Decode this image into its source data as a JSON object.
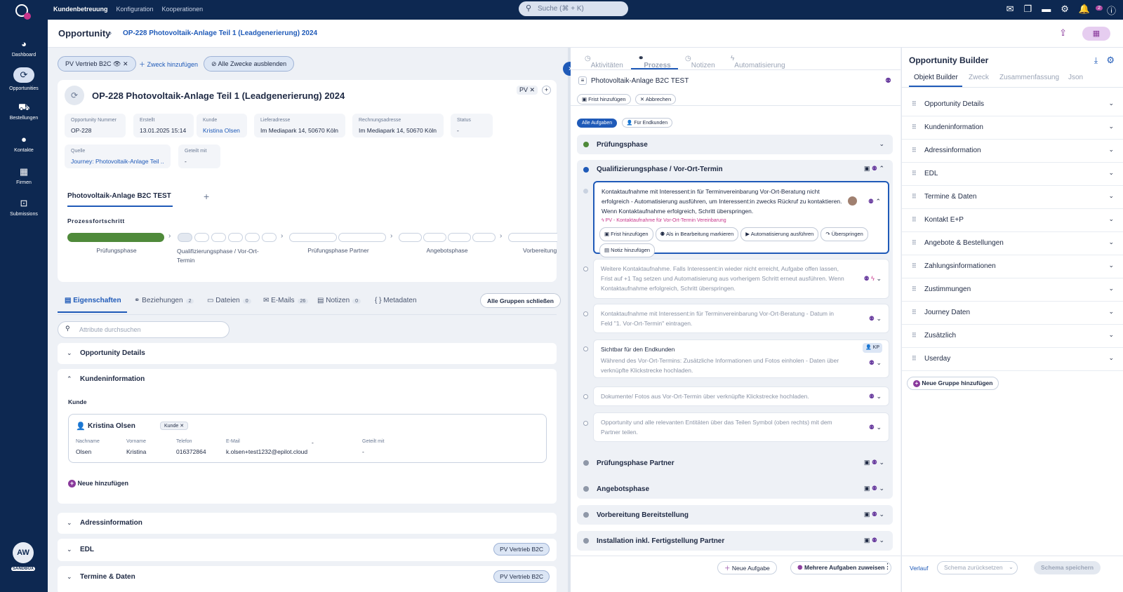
{
  "topnav": {
    "items": [
      "Kundenbetreuung",
      "Konfiguration",
      "Kooperationen"
    ],
    "search_placeholder": "Suche (⌘ + K)",
    "notifications_count": "2"
  },
  "sidebar": {
    "items": [
      "Dashboard",
      "Opportunities",
      "Bestellungen",
      "Kontakte",
      "Firmen",
      "Submissions"
    ],
    "avatar": "AW",
    "env": "SANDBOX"
  },
  "breadcrumb": {
    "root": "Opportunity",
    "current": "OP-228 Photovoltaik-Anlage Teil 1 (Leadgenerierung) 2024"
  },
  "purposes": {
    "chip": "PV Vertrieb B2C",
    "add": "Zweck hinzufügen",
    "hide_all": "Alle Zwecke ausblenden"
  },
  "header": {
    "title": "OP-228 Photovoltaik-Anlage Teil 1 (Leadgenerierung) 2024",
    "tag": "PV",
    "fields": [
      {
        "label": "Opportunity Nummer",
        "value": "OP-228"
      },
      {
        "label": "Erstellt",
        "value": "13.01.2025 15:14"
      },
      {
        "label": "Kunde",
        "value": "Kristina Olsen"
      },
      {
        "label": "Lieferadresse",
        "value": "Im Mediapark 14, 50670 Köln"
      },
      {
        "label": "Rechnungsadresse",
        "value": "Im Mediapark 14, 50670 Köln"
      },
      {
        "label": "Status",
        "value": "-"
      },
      {
        "label": "Quelle",
        "value": "Journey: Photovoltaik-Anlage Teil ..."
      },
      {
        "label": "Geteilt mit",
        "value": "-"
      }
    ]
  },
  "workflow": {
    "tab": "Photovoltaik-Anlage B2C TEST",
    "progress_title": "Prozessfortschritt",
    "phases": [
      "Prüfungsphase",
      "Qualifizierungsphase / Vor-Ort-Termin",
      "Prüfungsphase Partner",
      "Angebotsphase",
      "Vorbereitung"
    ]
  },
  "entity_tabs": [
    {
      "label": "Eigenschaften",
      "count": ""
    },
    {
      "label": "Beziehungen",
      "count": "2"
    },
    {
      "label": "Dateien",
      "count": "0"
    },
    {
      "label": "E-Mails",
      "count": "26"
    },
    {
      "label": "Notizen",
      "count": "0"
    },
    {
      "label": "Metadaten",
      "count": ""
    }
  ],
  "close_groups": "Alle Gruppen schließen",
  "attr_search_placeholder": "Attribute durchsuchen",
  "groups": {
    "details": "Opportunity Details",
    "customer": "Kundeninformation",
    "address": "Adressinformation",
    "edl": "EDL",
    "termine": "Termine & Daten",
    "purpose_badge": "PV Vertrieb B2C"
  },
  "customer": {
    "section_label": "Kunde",
    "name": "Kristina Olsen",
    "role": "Kunde",
    "columns": [
      "Nachname",
      "Vorname",
      "Telefon",
      "E-Mail",
      "",
      "Geteilt mit"
    ],
    "values": [
      "Olsen",
      "Kristina",
      "016372864",
      "k.olsen+test1232@epilot.cloud",
      "-",
      "-"
    ],
    "add_new": "Neue hinzufügen"
  },
  "process": {
    "tabs": [
      "Aktivitäten",
      "Prozess",
      "Notizen",
      "Automatisierung"
    ],
    "name": "Photovoltaik-Anlage B2C TEST",
    "add_deadline": "Frist hinzufügen",
    "cancel": "Abbrechen",
    "filter_all": "Alle Aufgaben",
    "filter_customer": "Für Endkunden",
    "phase1": "Prüfungsphase",
    "phase2": "Qualifizierungsphase / Vor-Ort-Termin",
    "task1": "Kontaktaufnahme mit Interessent:in für Terminvereinbarung Vor-Ort-Beratung nicht erfolgreich - Automatisierung ausführen, um Interessent:in zwecks Rückruf zu kontaktieren. Wenn Kontaktaufnahme erfolgreich, Schritt überspringen.",
    "task1_automation": "PV - Kontaktaufnahme für Vor-Ort-Termin Vereinbarung",
    "task1_buttons": [
      "Frist hinzufügen",
      "Als in Bearbeitung markieren",
      "Automatisierung ausführen",
      "Überspringen"
    ],
    "task1_note": "Notiz hinzufügen",
    "task2": "Weitere Kontaktaufnahme. Falls Interessent:in wieder nicht erreicht, Aufgabe offen lassen, Frist auf +1 Tag setzen und Automatisierung aus vorherigem Schritt erneut ausführen. Wenn Kontaktaufnahme erfolgreich, Schritt überspringen.",
    "task3": "Kontaktaufnahme mit Interessent:in für Terminvereinbarung Vor-Ort-Beratung - Datum in Feld \"1. Vor-Ort-Termin\" eintragen.",
    "task4_header": "Sichtbar für den Endkunden",
    "task4_badge": "KP",
    "task4": "Während des Vor-Ort-Termins: Zusätzliche Informationen und Fotos einholen - Daten über verknüpfte Klickstrecke hochladen.",
    "task5": "Dokumente/ Fotos aus Vor-Ort-Termin über verknüpfte Klickstrecke hochladen.",
    "task6": "Opportunity und alle relevanten Entitäten über das Teilen Symbol (oben rechts) mit dem Partner teilen.",
    "phase3": "Prüfungsphase Partner",
    "phase4": "Angebotsphase",
    "phase5": "Vorbereitung Bereitstellung",
    "phase6": "Installation inkl. Fertigstellung Partner",
    "new_task": "Neue Aufgabe",
    "assign": "Mehrere Aufgaben zuweisen"
  },
  "builder": {
    "title": "Opportunity Builder",
    "tabs": [
      "Objekt Builder",
      "Zweck",
      "Zusammenfassung",
      "Json"
    ],
    "groups": [
      "Opportunity Details",
      "Kundeninformation",
      "Adressinformation",
      "EDL",
      "Termine & Daten",
      "Kontakt E+P",
      "Angebote & Bestellungen",
      "Zahlungsinformationen",
      "Zustimmungen",
      "Journey Daten",
      "Zusätzlich",
      "Userday"
    ],
    "add_group": "Neue Gruppe hinzufügen",
    "history": "Verlauf",
    "reset": "Schema zurücksetzen",
    "save": "Schema speichern"
  },
  "colors": {
    "nav": "#0d2851",
    "accent": "#1f5ab8",
    "progress_done": "#4f8a3a",
    "purple": "#8a3a9c"
  }
}
